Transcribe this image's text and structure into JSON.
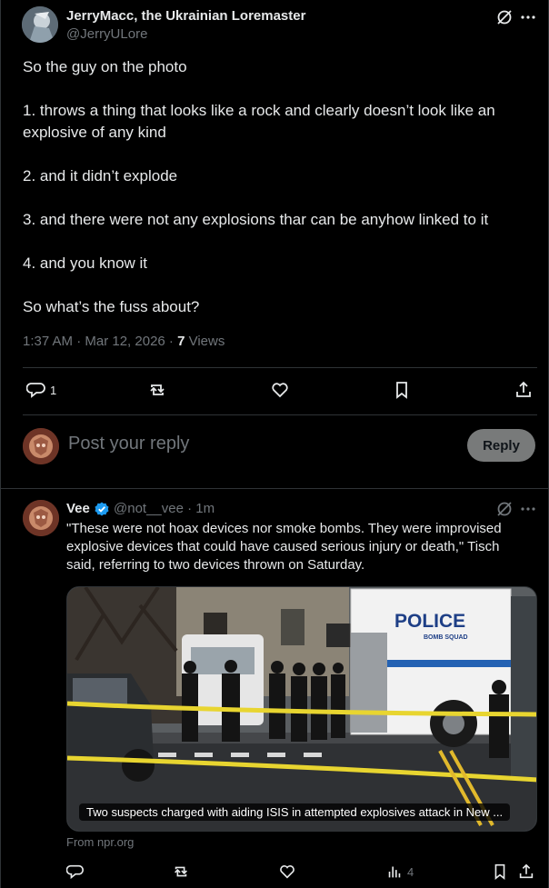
{
  "tweet": {
    "author_name": "JerryMacc, the Ukrainian Loremaster",
    "author_handle": "@JerryULore",
    "paragraphs": [
      "So the guy on the photo",
      "1.  throws a thing that looks like a rock and clearly doesn’t look like an explosive of any kind",
      "2. and it didn’t explode",
      "3. and there were not any explosions thar can be anyhow linked to it",
      "4. and you know it",
      "So what’s the fuss about?"
    ],
    "timestamp": "1:37 AM · Mar 12, 2026 · ",
    "views_count": "7",
    "views_label": " Views",
    "reply_count": "1",
    "icons": [
      "grok-icon",
      "more-icon",
      "reply-icon",
      "repost-icon",
      "like-icon",
      "bookmark-icon",
      "share-icon"
    ]
  },
  "composer": {
    "placeholder": "Post your reply",
    "reply_button": "Reply"
  },
  "reply": {
    "author_name": "Vee",
    "author_handle": "@not__vee · 1m",
    "text": "\"These were not hoax devices nor smoke bombs. They were improvised explosive devices that could have caused serious injury or death,\" Tisch said, referring to two devices thrown on Saturday.",
    "card_caption": "Two suspects charged with aiding ISIS in attempted explosives attack in New ...",
    "card_source": "From npr.org",
    "views_count": "4",
    "verified_color": "#1d9bf0"
  },
  "photo_signage": {
    "police": "POLICE",
    "bomb_squad": "BOMB SQUAD"
  },
  "colors": {
    "background": "#000000",
    "text": "#e7e9ea",
    "muted": "#71767b",
    "border": "#2f3336",
    "reply_button_bg": "#787a7a"
  }
}
